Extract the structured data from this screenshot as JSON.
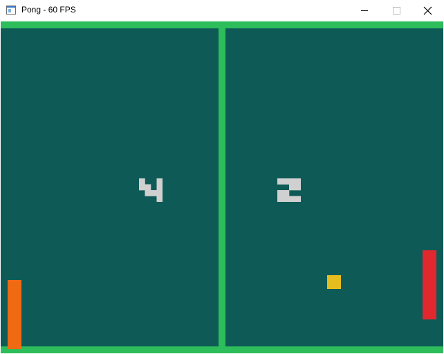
{
  "window": {
    "title": "Pong - 60 FPS",
    "app_icon": "window-app-icon",
    "controls": {
      "minimize_icon": "minimize-icon",
      "maximize_icon": "maximize-icon",
      "close_icon": "close-icon"
    }
  },
  "game": {
    "colors": {
      "background": "#0e5a56",
      "walls": "#2dbd5a",
      "score": "#d0d0d0",
      "left_paddle": "#f06a14",
      "right_paddle": "#e0282e",
      "ball": "#e6bd1e"
    },
    "score": {
      "left": "4",
      "right": "2"
    }
  }
}
